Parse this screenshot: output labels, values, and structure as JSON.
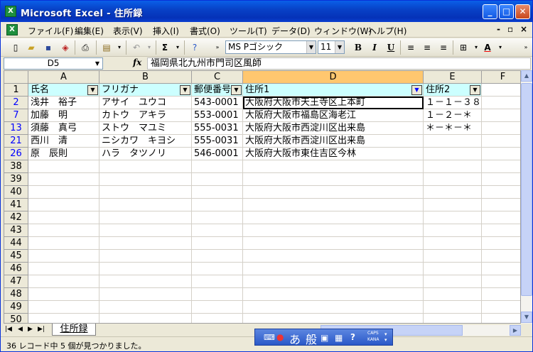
{
  "window": {
    "title": "Microsoft Excel - 住所録",
    "app_icon": "X"
  },
  "menu": [
    "ファイル(F)",
    "編集(E)",
    "表示(V)",
    "挿入(I)",
    "書式(O)",
    "ツール(T)",
    "データ(D)",
    "ウィンドウ(W)",
    "ヘルプ(H)"
  ],
  "toolbar": {
    "font": "MS Pゴシック",
    "size": "11",
    "bold": "B",
    "italic": "I",
    "underline": "U",
    "sigma": "Σ"
  },
  "namebox": "D5",
  "formula": "福岡県北九州市門司区風師",
  "columns": [
    "A",
    "B",
    "C",
    "D",
    "E",
    "F"
  ],
  "header_row": {
    "row": "1",
    "cells": [
      "氏名",
      "フリガナ",
      "郵便番号",
      "住所1",
      "住所2"
    ]
  },
  "rows": [
    {
      "row": "2",
      "cells": [
        "浅井　裕子",
        "アサイ　ユウコ",
        "543-0001",
        "大阪府大阪市天王寺区上本町",
        "１－１－３８"
      ]
    },
    {
      "row": "7",
      "cells": [
        "加藤　明",
        "カトウ　アキラ",
        "553-0001",
        "大阪府大阪市福島区海老江",
        "１－２－＊"
      ]
    },
    {
      "row": "13",
      "cells": [
        "須藤　真弓",
        "ストウ　マユミ",
        "555-0031",
        "大阪府大阪市西淀川区出来島",
        "＊－＊－＊"
      ]
    },
    {
      "row": "21",
      "cells": [
        "西川　清",
        "ニシカワ　キヨシ",
        "555-0031",
        "大阪府大阪市西淀川区出来島",
        ""
      ]
    },
    {
      "row": "26",
      "cells": [
        "原　辰則",
        "ハラ　タツノリ",
        "546-0001",
        "大阪府大阪市東住吉区今林",
        ""
      ]
    }
  ],
  "empty_rows": [
    "38",
    "39",
    "40",
    "41",
    "42",
    "43",
    "44",
    "45",
    "46",
    "47",
    "48",
    "49",
    "50"
  ],
  "sheet_tab": "住所録",
  "status": "36 レコード中 5 個が見つかりました。",
  "ime": {
    "mode": "あ",
    "kanji": "般",
    "caps": "CAPS",
    "kana": "KANA"
  },
  "colors": {
    "title_bar": "#0842c7",
    "header_fill": "#ccffff",
    "selected_header": "#ffc76f",
    "filtered_row_number": "#0000ff"
  }
}
